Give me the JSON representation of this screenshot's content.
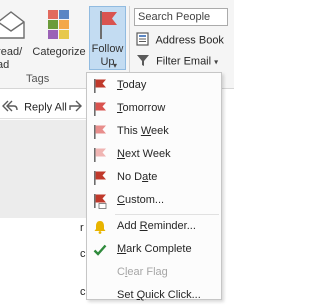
{
  "ribbon": {
    "read_label": "Unread/\nRead",
    "categorize_label": "Categorize",
    "follow_up_label": "Follow\nUp",
    "tags_group_label": "Tags",
    "search_people_placeholder": "Search People",
    "address_book_label": "Address Book",
    "filter_email_label": "Filter Email"
  },
  "toolbar": {
    "reply_all_label": "Reply All"
  },
  "content_fragments": [
    "r",
    "c",
    "c"
  ],
  "follow_up_menu": {
    "items": [
      {
        "label": "Today",
        "icon": "flag-icon",
        "flag_color": "#c0392b"
      },
      {
        "label": "Tomorrow",
        "icon": "flag-icon",
        "flag_color": "#d9534f"
      },
      {
        "label": "This Week",
        "icon": "flag-icon",
        "flag_color": "#e88e8c"
      },
      {
        "label": "Next Week",
        "icon": "flag-icon",
        "flag_color": "#f0b5b3"
      },
      {
        "label": "No Date",
        "icon": "flag-icon",
        "flag_color": "#c0392b"
      },
      {
        "label": "Custom...",
        "icon": "flag-icon",
        "flag_color": "#c0392b"
      },
      {
        "label": "Add Reminder...",
        "icon": "bell-icon",
        "icon_color": "#e8b400"
      },
      {
        "label": "Mark Complete",
        "icon": "checkmark-icon",
        "icon_color": "#2f8a3c"
      },
      {
        "label": "Clear Flag",
        "icon": "none",
        "disabled": true
      },
      {
        "label": "Set Quick Click...",
        "icon": "none"
      }
    ]
  },
  "colors": {
    "accent_flag": "#c0392b",
    "selected_button_bg": "#c3dcf2",
    "checkmark": "#2f8a3c",
    "bell": "#e8b400"
  }
}
